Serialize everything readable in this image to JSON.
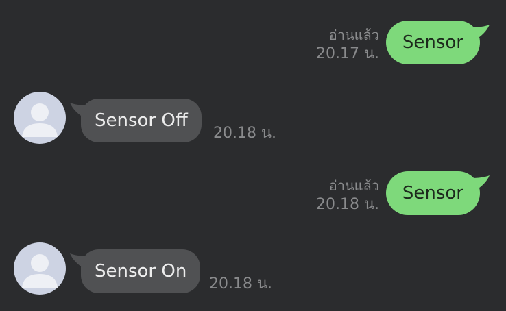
{
  "messages": [
    {
      "direction": "sent",
      "text": "Sensor",
      "read": "อ่านแล้ว",
      "time": "20.17 น."
    },
    {
      "direction": "received",
      "text": "Sensor Off",
      "time": "20.18 น.",
      "avatar_icon": "default-profile-icon"
    },
    {
      "direction": "sent",
      "text": "Sensor",
      "read": "อ่านแล้ว",
      "time": "20.18 น."
    },
    {
      "direction": "received",
      "text": "Sensor On",
      "time": "20.18 น.",
      "avatar_icon": "default-profile-icon"
    }
  ],
  "colors": {
    "background": "#2b2c2e",
    "sent_bubble": "#7ed97b",
    "received_bubble": "#505153",
    "avatar": "#cdd3e3",
    "meta_text": "#8a8b8d"
  }
}
